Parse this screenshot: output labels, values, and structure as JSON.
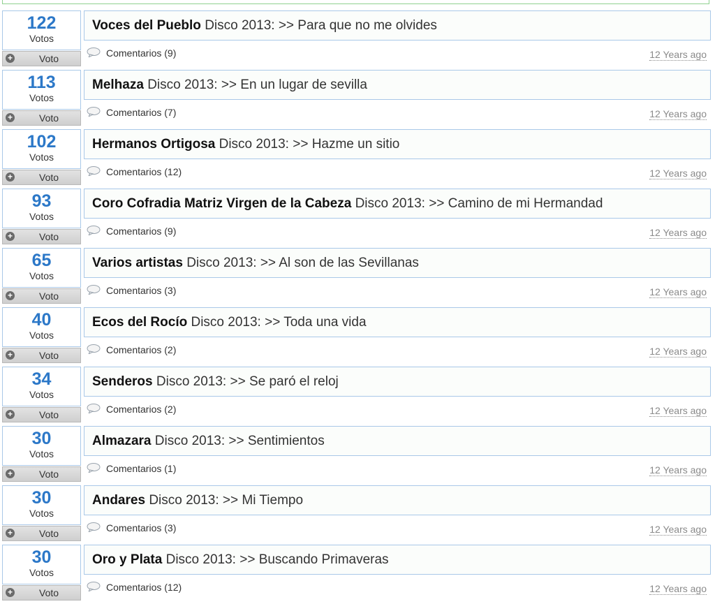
{
  "items": [
    {
      "votes": "122",
      "votes_label": "Votos",
      "vote_button": "Voto",
      "artist": "Voces del Pueblo",
      "album_text": "Disco 2013: >> Para que no me olvides",
      "comments": "Comentarios (9)",
      "time": "12 Years ago"
    },
    {
      "votes": "113",
      "votes_label": "Votos",
      "vote_button": "Voto",
      "artist": "Melhaza",
      "album_text": "Disco 2013: >> En un lugar de sevilla",
      "comments": "Comentarios (7)",
      "time": "12 Years ago"
    },
    {
      "votes": "102",
      "votes_label": "Votos",
      "vote_button": "Voto",
      "artist": "Hermanos Ortigosa",
      "album_text": "Disco 2013: >> Hazme un sitio",
      "comments": "Comentarios (12)",
      "time": "12 Years ago"
    },
    {
      "votes": "93",
      "votes_label": "Votos",
      "vote_button": "Voto",
      "artist": "Coro Cofradia Matriz Virgen de la Cabeza",
      "album_text": "Disco 2013: >> Camino de mi Hermandad",
      "comments": "Comentarios (9)",
      "time": "12 Years ago"
    },
    {
      "votes": "65",
      "votes_label": "Votos",
      "vote_button": "Voto",
      "artist": "Varios artistas",
      "album_text": "Disco 2013: >> Al son de las Sevillanas",
      "comments": "Comentarios (3)",
      "time": "12 Years ago"
    },
    {
      "votes": "40",
      "votes_label": "Votos",
      "vote_button": "Voto",
      "artist": "Ecos del Rocío",
      "album_text": "Disco 2013: >> Toda una vida",
      "comments": "Comentarios (2)",
      "time": "12 Years ago"
    },
    {
      "votes": "34",
      "votes_label": "Votos",
      "vote_button": "Voto",
      "artist": "Senderos",
      "album_text": "Disco 2013: >> Se paró el reloj",
      "comments": "Comentarios (2)",
      "time": "12 Years ago"
    },
    {
      "votes": "30",
      "votes_label": "Votos",
      "vote_button": "Voto",
      "artist": "Almazara",
      "album_text": "Disco 2013: >> Sentimientos",
      "comments": "Comentarios (1)",
      "time": "12 Years ago"
    },
    {
      "votes": "30",
      "votes_label": "Votos",
      "vote_button": "Voto",
      "artist": "Andares",
      "album_text": "Disco 2013: >> Mi Tiempo",
      "comments": "Comentarios (3)",
      "time": "12 Years ago"
    },
    {
      "votes": "30",
      "votes_label": "Votos",
      "vote_button": "Voto",
      "artist": "Oro y Plata",
      "album_text": "Disco 2013: >> Buscando Primaveras",
      "comments": "Comentarios (12)",
      "time": "12 Years ago"
    }
  ],
  "icons": {
    "vote_button_icon": "plus-circle-icon",
    "comments_icon": "speech-bubble-icon"
  },
  "colors": {
    "vote_count": "#2c78c8",
    "box_border": "#a9c8e8",
    "top_border": "#8fd08f"
  }
}
